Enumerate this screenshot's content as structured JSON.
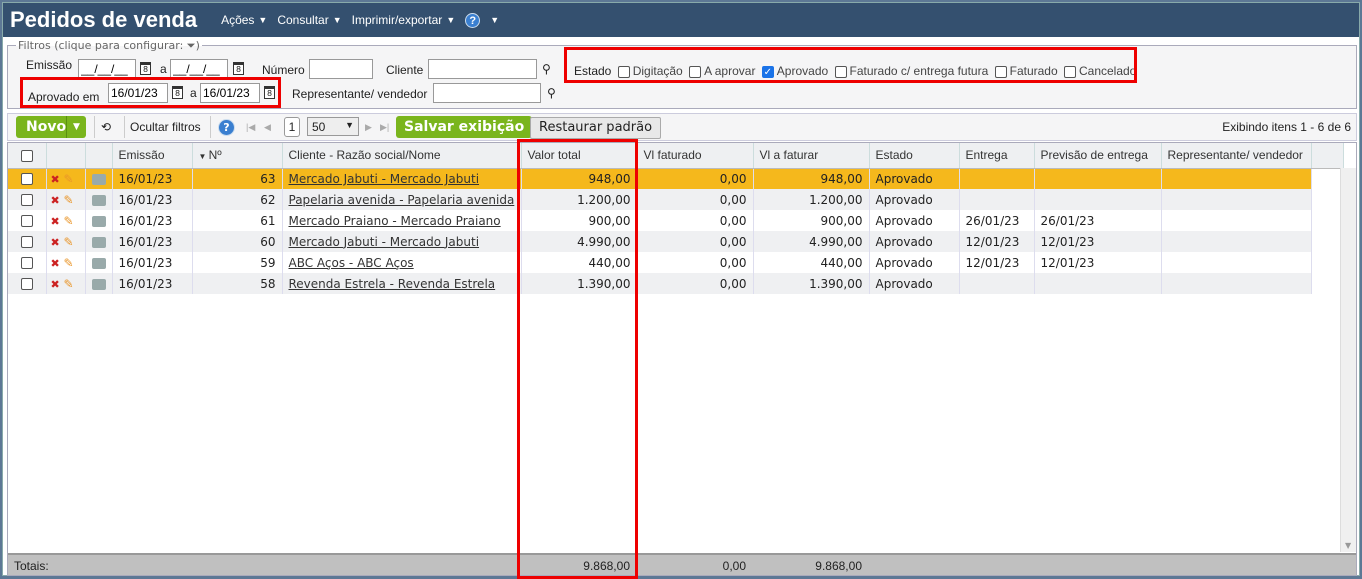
{
  "header": {
    "title": "Pedidos de venda",
    "menus": [
      "Ações",
      "Consultar",
      "Imprimir/exportar"
    ],
    "help": "?"
  },
  "filters": {
    "legend": "Filtros (clique para configurar:",
    "legend_end": ")",
    "emissao_label": "Emissão",
    "emissao_from": "__/__/__",
    "emissao_sep": "a",
    "emissao_to": "__/__/__",
    "numero_label": "Número",
    "numero_value": "",
    "cliente_label": "Cliente",
    "cliente_value": "",
    "aprovado_label": "Aprovado em",
    "aprovado_from": "16/01/23",
    "aprovado_sep": "a",
    "aprovado_to": "16/01/23",
    "representante_label": "Representante/ vendedor",
    "representante_value": "",
    "estado_label": "Estado",
    "estados": [
      {
        "label": "Digitação",
        "checked": false
      },
      {
        "label": "A aprovar",
        "checked": false
      },
      {
        "label": "Aprovado",
        "checked": true
      },
      {
        "label": "Faturado c/ entrega futura",
        "checked": false
      },
      {
        "label": "Faturado",
        "checked": false
      },
      {
        "label": "Cancelado",
        "checked": false
      }
    ]
  },
  "toolbar": {
    "novo": "Novo",
    "ocultar": "Ocultar filtros",
    "page": "1",
    "page_size": "50",
    "salvar": "Salvar exibição",
    "restaurar": "Restaurar padrão",
    "exibindo": "Exibindo itens 1 - 6 de 6"
  },
  "table": {
    "columns": [
      "Emissão",
      "Nº",
      "Cliente - Razão social/Nome",
      "Valor total",
      "Vl faturado",
      "Vl a faturar",
      "Estado",
      "Entrega",
      "Previsão de entrega",
      "Representante/ vendedor"
    ],
    "rows": [
      [
        "16/01/23",
        "63",
        "Mercado Jabuti - Mercado Jabuti",
        "948,00",
        "0,00",
        "948,00",
        "Aprovado",
        "",
        "",
        ""
      ],
      [
        "16/01/23",
        "62",
        "Papelaria avenida - Papelaria avenida",
        "1.200,00",
        "0,00",
        "1.200,00",
        "Aprovado",
        "",
        "",
        ""
      ],
      [
        "16/01/23",
        "61",
        "Mercado Praiano - Mercado Praiano",
        "900,00",
        "0,00",
        "900,00",
        "Aprovado",
        "26/01/23",
        "26/01/23",
        ""
      ],
      [
        "16/01/23",
        "60",
        "Mercado Jabuti - Mercado Jabuti",
        "4.990,00",
        "0,00",
        "4.990,00",
        "Aprovado",
        "12/01/23",
        "12/01/23",
        ""
      ],
      [
        "16/01/23",
        "59",
        "ABC Aços - ABC Aços",
        "440,00",
        "0,00",
        "440,00",
        "Aprovado",
        "12/01/23",
        "12/01/23",
        ""
      ],
      [
        "16/01/23",
        "58",
        "Revenda Estrela - Revenda Estrela",
        "1.390,00",
        "0,00",
        "1.390,00",
        "Aprovado",
        "",
        "",
        ""
      ]
    ],
    "totals": {
      "label": "Totais:",
      "valor_total": "9.868,00",
      "vl_faturado": "0,00",
      "vl_a_faturar": "9.868,00"
    }
  }
}
